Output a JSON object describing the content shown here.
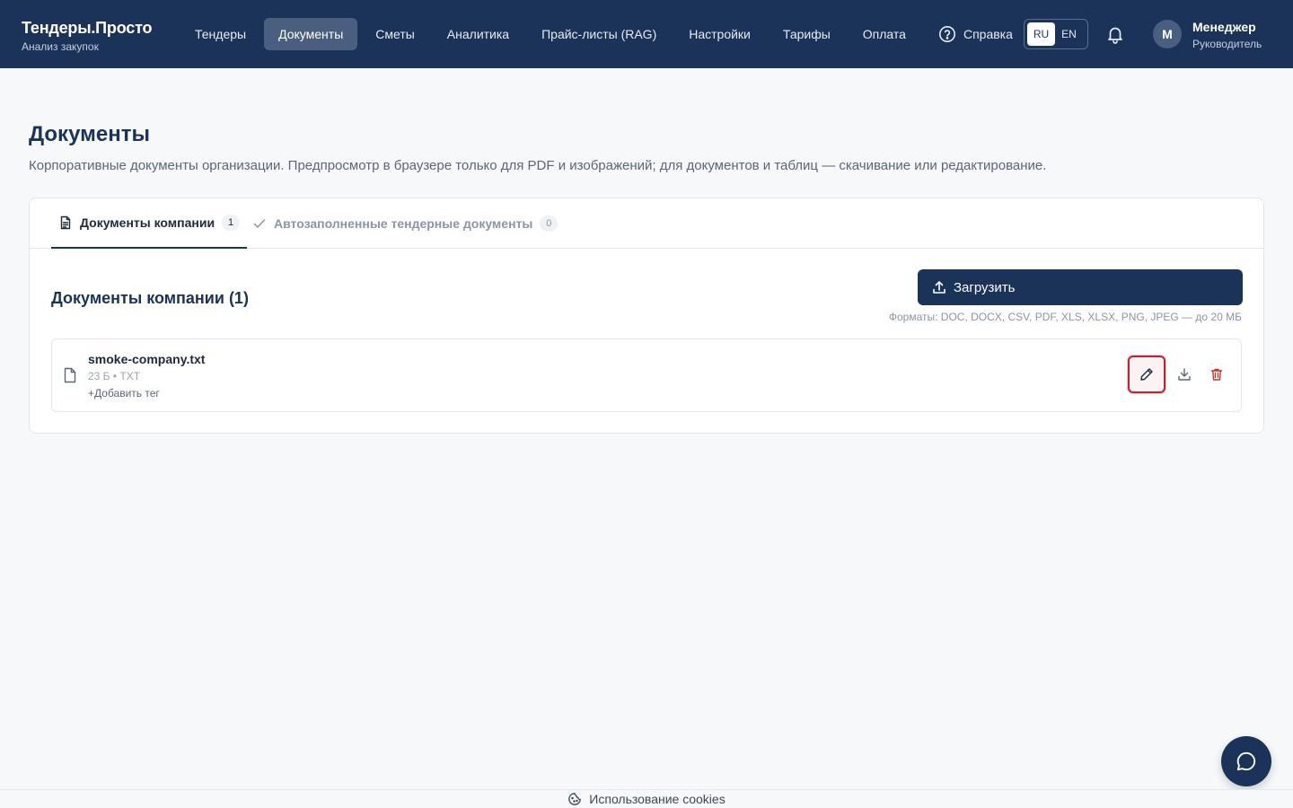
{
  "brand": {
    "title": "Тендеры.Просто",
    "subtitle": "Анализ закупок"
  },
  "nav": {
    "items": [
      {
        "label": "Тендеры"
      },
      {
        "label": "Документы"
      },
      {
        "label": "Сметы"
      },
      {
        "label": "Аналитика"
      },
      {
        "label": "Прайс-листы (RAG)"
      },
      {
        "label": "Настройки"
      },
      {
        "label": "Тарифы"
      },
      {
        "label": "Оплата"
      },
      {
        "label": "Справка"
      }
    ],
    "active_index": 1
  },
  "lang": {
    "ru": "RU",
    "en": "EN",
    "active": "RU"
  },
  "user": {
    "initial": "M",
    "name": "Менеджер",
    "role": "Руководитель"
  },
  "page": {
    "title": "Документы",
    "description": "Корпоративные документы организации. Предпросмотр в браузере только для PDF и изображений; для документов и таблиц — скачивание или редактирование."
  },
  "tabs": [
    {
      "label": "Документы компании",
      "count": "1",
      "icon": "document-icon"
    },
    {
      "label": "Автозаполненные тендерные документы",
      "count": "0",
      "icon": "check-icon"
    }
  ],
  "section": {
    "title": "Документы компании (1)",
    "upload_label": "Загрузить",
    "formats": "Форматы: DOC, DOCX, CSV, PDF, XLS, XLSX, PNG, JPEG — до 20 МБ"
  },
  "files": [
    {
      "name": "smoke-company.txt",
      "meta": "23 Б • TXT",
      "add_tag": "Добавить тег"
    }
  ],
  "cookie": {
    "label": "Использование cookies"
  },
  "colors": {
    "primary": "#1b3358",
    "danger": "#b4283a",
    "background": "#f7f8fa"
  }
}
